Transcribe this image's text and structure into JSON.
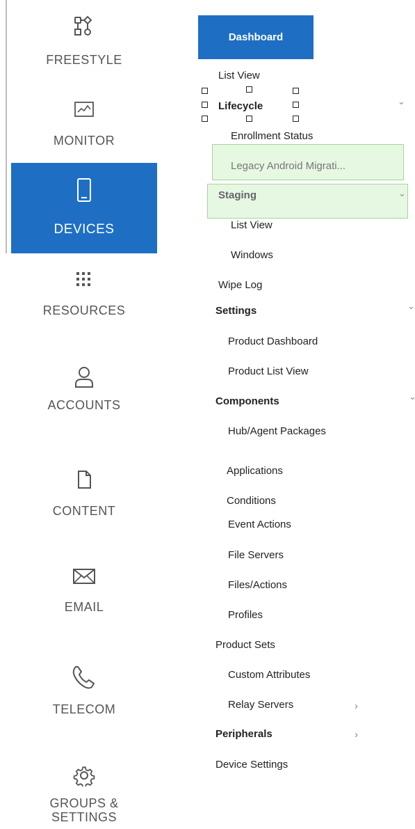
{
  "rail": {
    "items": [
      {
        "label": "FREESTYLE",
        "icon": "freestyle-icon"
      },
      {
        "label": "MONITOR",
        "icon": "monitor-icon"
      },
      {
        "label": "DEVICES",
        "icon": "devices-icon",
        "active": true
      },
      {
        "label": "RESOURCES",
        "icon": "resources-icon"
      },
      {
        "label": "ACCOUNTS",
        "icon": "accounts-icon"
      },
      {
        "label": "CONTENT",
        "icon": "content-icon"
      },
      {
        "label": "EMAIL",
        "icon": "email-icon"
      },
      {
        "label": "TELECOM",
        "icon": "telecom-icon"
      },
      {
        "label": "GROUPS & SETTINGS",
        "label_line1": "GROUPS &",
        "label_line2": "SETTINGS",
        "icon": "gear-icon"
      }
    ],
    "accent": "#1e6fc4"
  },
  "nav": {
    "dashboard": "Dashboard",
    "list_view": "List View",
    "lifecycle": "Lifecycle",
    "enrollment_status": "Enrollment Status",
    "legacy_android": "Legacy Android Migrati...",
    "staging": "Staging",
    "staging_list_view": "List View",
    "windows": "Windows",
    "wipe_log": "Wipe Log",
    "settings": "Settings",
    "product_dashboard": "Product Dashboard",
    "product_list_view": "Product List View",
    "components": "Components",
    "hub_agent_packages": "Hub/Agent Packages",
    "applications": "Applications",
    "conditions": "Conditions",
    "event_actions": "Event Actions",
    "file_servers": "File Servers",
    "files_actions": "Files/Actions",
    "profiles": "Profiles",
    "product_sets": "Product Sets",
    "custom_attributes": "Custom Attributes",
    "relay_servers": "Relay Servers",
    "peripherals": "Peripherals",
    "device_settings": "Device Settings",
    "chev_down": "⌄",
    "chev_right": "›",
    "highlight_color": "#e6f7e2"
  }
}
